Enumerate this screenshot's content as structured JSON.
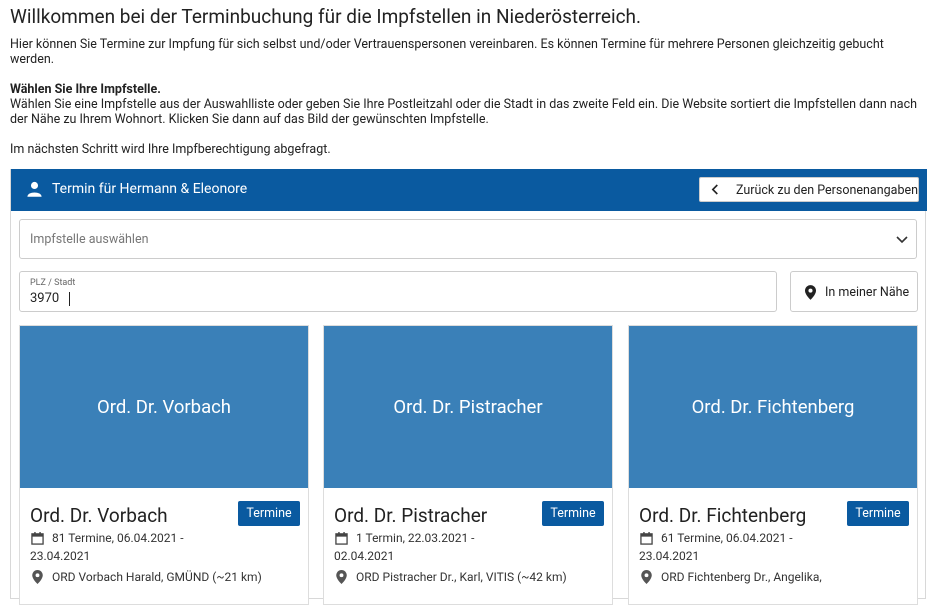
{
  "intro": {
    "title": "Willkommen bei der Terminbuchung für die Impfstellen in Niederösterreich.",
    "paragraph1": "Hier können Sie Termine zur Impfung für sich selbst und/oder Vertrauenspersonen vereinbaren. Es können Termine für mehrere Personen gleichzeitig gebucht werden.",
    "heading2": "Wählen Sie Ihre Impfstelle.",
    "paragraph2": "Wählen Sie eine Impfstelle aus der Auswahlliste oder geben Sie Ihre Postleitzahl oder die Stadt in das zweite Feld ein. Die Website sortiert die Impfstellen dann nach der Nähe zu Ihrem Wohnort. Klicken Sie dann auf das Bild der gewünschten Impfstelle.",
    "paragraph3": "Im nächsten Schritt wird Ihre Impfberechtigung abgefragt."
  },
  "panel": {
    "title": "Termin für Hermann & Eleonore",
    "back_label": "Zurück zu den Personenangaben",
    "select_placeholder": "Impfstelle auswählen",
    "plz_label": "PLZ / Stadt",
    "plz_value": "3970",
    "near_label": "In meiner Nähe"
  },
  "colors": {
    "header": "#0a5aa0",
    "card_image": "#3a80b8",
    "button": "#0a5aa0"
  },
  "icons": {
    "person": "person-icon",
    "back": "chevron-left-icon",
    "select": "chevron-down-icon",
    "location": "location-pin-icon",
    "calendar": "calendar-icon"
  },
  "cards": [
    {
      "image_label": "Ord. Dr. Vorbach",
      "name": "Ord. Dr. Vorbach",
      "button": "Termine",
      "summary_line1": "81 Termine, 06.04.2021 -",
      "summary_line2": "23.04.2021",
      "address": "ORD Vorbach Harald, GMÜND   (~21 km)"
    },
    {
      "image_label": "Ord. Dr. Pistracher",
      "name": "Ord. Dr. Pistracher",
      "button": "Termine",
      "summary_line1": "1 Termin, 22.03.2021 -",
      "summary_line2": "02.04.2021",
      "address": "ORD Pistracher Dr., Karl, VITIS   (~42 km)"
    },
    {
      "image_label": "Ord. Dr. Fichtenberg",
      "name": "Ord. Dr. Fichtenberg",
      "button": "Termine",
      "summary_line1": "61 Termine, 06.04.2021 -",
      "summary_line2": "23.04.2021",
      "address": "ORD Fichtenberg Dr., Angelika,"
    }
  ]
}
